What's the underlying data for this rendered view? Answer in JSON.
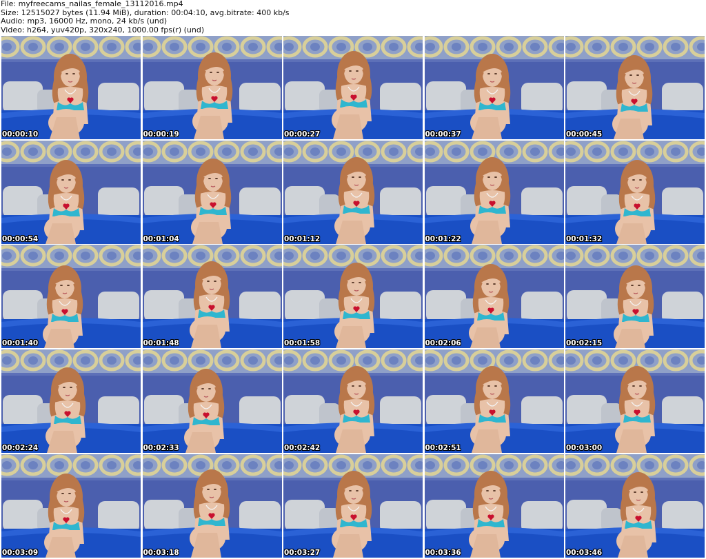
{
  "header": {
    "file_line": "File: myfreecams_nailas_female_13112016.mp4",
    "size_line": "Size: 12515027 bytes (11.94 MiB), duration: 00:04:10, avg.bitrate: 400 kb/s",
    "audio_line": "Audio: mp3, 16000 Hz, mono, 24 kb/s (und)",
    "video_line": "Video: h264, yuv420p, 320x240, 1000.00 fps(r) (und)"
  },
  "thumbnails": [
    {
      "timestamp": "00:00:10"
    },
    {
      "timestamp": "00:00:19"
    },
    {
      "timestamp": "00:00:27"
    },
    {
      "timestamp": "00:00:37"
    },
    {
      "timestamp": "00:00:45"
    },
    {
      "timestamp": "00:00:54"
    },
    {
      "timestamp": "00:01:04"
    },
    {
      "timestamp": "00:01:12"
    },
    {
      "timestamp": "00:01:22"
    },
    {
      "timestamp": "00:01:32"
    },
    {
      "timestamp": "00:01:40"
    },
    {
      "timestamp": "00:01:48"
    },
    {
      "timestamp": "00:01:58"
    },
    {
      "timestamp": "00:02:06"
    },
    {
      "timestamp": "00:02:15"
    },
    {
      "timestamp": "00:02:24"
    },
    {
      "timestamp": "00:02:33"
    },
    {
      "timestamp": "00:02:42"
    },
    {
      "timestamp": "00:02:51"
    },
    {
      "timestamp": "00:03:00"
    },
    {
      "timestamp": "00:03:09"
    },
    {
      "timestamp": "00:03:18"
    },
    {
      "timestamp": "00:03:27"
    },
    {
      "timestamp": "00:03:36"
    },
    {
      "timestamp": "00:03:46"
    }
  ],
  "colors": {
    "wall": "#4b5fae",
    "wallpaper_band": "#8fa0c8",
    "wallpaper_ring": "#d8cf9a",
    "sofa": "#1a4fc4",
    "pillow": "#cfd3d8",
    "hair": "#b9774a",
    "skin": "#e8c2a8",
    "top": "#2fb6cf",
    "heart": "#c8102e",
    "timestamp_text": "#ffffff",
    "header_text": "#111111"
  }
}
